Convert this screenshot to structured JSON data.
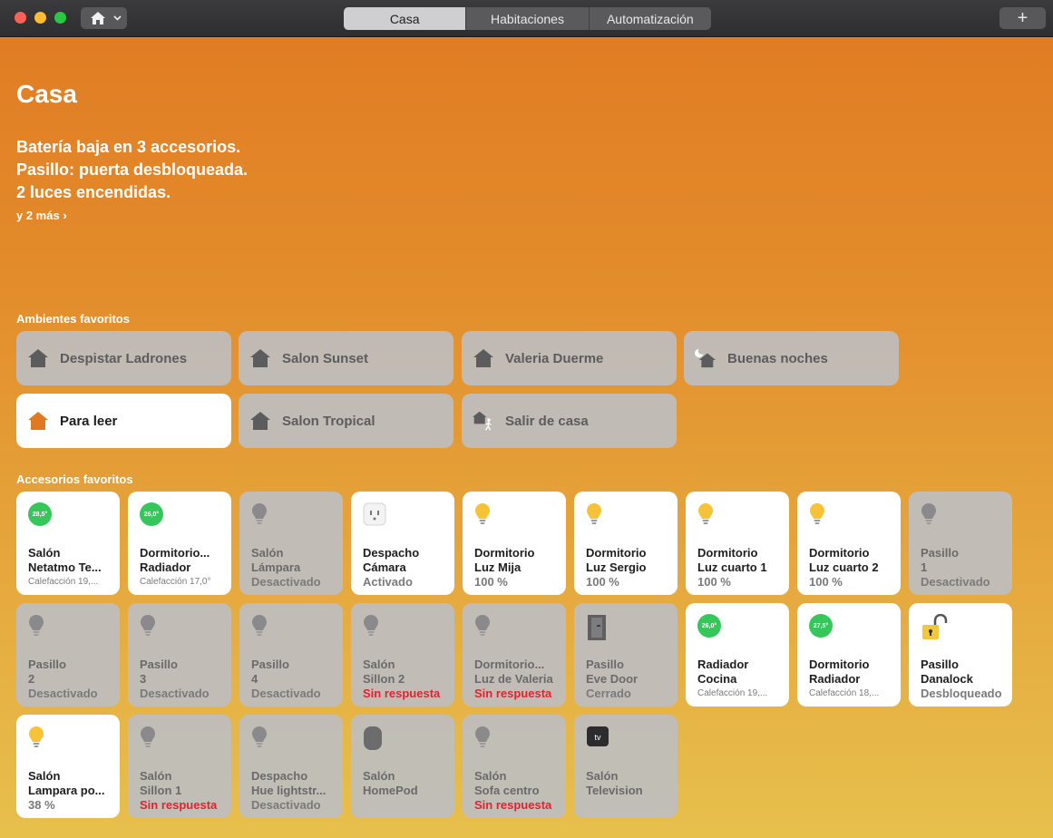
{
  "toolbar": {
    "tabs": [
      {
        "label": "Casa",
        "active": true
      },
      {
        "label": "Habitaciones",
        "active": false
      },
      {
        "label": "Automatización",
        "active": false
      }
    ],
    "add_label": "+"
  },
  "page": {
    "title": "Casa",
    "status_lines": [
      "Batería baja en 3 accesorios.",
      "Pasillo: puerta desbloqueada.",
      "2 luces encendidas."
    ],
    "more_link": "y 2 más ›"
  },
  "scenes_section": {
    "title": "Ambientes favoritos",
    "items": [
      {
        "label": "Despistar Ladrones",
        "on": false,
        "icon": "house-icon"
      },
      {
        "label": "Salon Sunset",
        "on": false,
        "icon": "house-icon"
      },
      {
        "label": "Valeria Duerme",
        "on": false,
        "icon": "house-icon"
      },
      {
        "label": "Buenas noches",
        "on": false,
        "icon": "moon-house-icon"
      },
      {
        "label": "Para leer",
        "on": true,
        "icon": "house-icon"
      },
      {
        "label": "Salon Tropical",
        "on": false,
        "icon": "house-icon"
      },
      {
        "label": "Salir de casa",
        "on": false,
        "icon": "leave-house-icon"
      }
    ]
  },
  "accessories_section": {
    "title": "Accesorios favoritos",
    "items": [
      {
        "room": "Salón",
        "name": "Netatmo Te...",
        "state": "Calefacción 19,...",
        "badge": "28,5°",
        "on": true,
        "icon": "thermostat-icon"
      },
      {
        "room": "Dormitorio...",
        "name": "Radiador",
        "state": "Calefacción 17,0°",
        "badge": "26,0°",
        "on": true,
        "icon": "thermostat-icon"
      },
      {
        "room": "Salón",
        "name": "Lámpara",
        "state": "Desactivado",
        "on": false,
        "icon": "bulb-icon"
      },
      {
        "room": "Despacho",
        "name": "Cámara",
        "state": "Activado",
        "on": true,
        "icon": "outlet-icon"
      },
      {
        "room": "Dormitorio",
        "name": "Luz Mija",
        "state": "100 %",
        "on": true,
        "icon": "bulb-icon"
      },
      {
        "room": "Dormitorio",
        "name": "Luz Sergio",
        "state": "100 %",
        "on": true,
        "icon": "bulb-icon"
      },
      {
        "room": "Dormitorio",
        "name": "Luz cuarto 1",
        "state": "100 %",
        "on": true,
        "icon": "bulb-icon"
      },
      {
        "room": "Dormitorio",
        "name": "Luz cuarto 2",
        "state": "100 %",
        "on": true,
        "icon": "bulb-icon"
      },
      {
        "room": "Pasillo",
        "name": "1",
        "state": "Desactivado",
        "on": false,
        "icon": "bulb-icon"
      },
      {
        "room": "Pasillo",
        "name": "2",
        "state": "Desactivado",
        "on": false,
        "icon": "bulb-icon"
      },
      {
        "room": "Pasillo",
        "name": "3",
        "state": "Desactivado",
        "on": false,
        "icon": "bulb-icon"
      },
      {
        "room": "Pasillo",
        "name": "4",
        "state": "Desactivado",
        "on": false,
        "icon": "bulb-icon"
      },
      {
        "room": "Salón",
        "name": "Sillon 2",
        "state": "Sin respuesta",
        "on": false,
        "alert": true,
        "icon": "bulb-icon"
      },
      {
        "room": "Dormitorio...",
        "name": "Luz de Valeria",
        "state": "Sin respuesta",
        "on": false,
        "alert": true,
        "icon": "bulb-icon"
      },
      {
        "room": "Pasillo",
        "name": "Eve Door",
        "state": "Cerrado",
        "on": false,
        "icon": "door-icon"
      },
      {
        "room": "Radiador",
        "name": "Cocina",
        "state": "Calefacción 19,...",
        "badge": "26,0°",
        "on": true,
        "icon": "thermostat-icon"
      },
      {
        "room": "Dormitorio",
        "name": "Radiador",
        "state": "Calefacción 18,...",
        "badge": "27,5°",
        "on": true,
        "icon": "thermostat-icon"
      },
      {
        "room": "Pasillo",
        "name": "Danalock",
        "state": "Desbloqueado",
        "on": true,
        "alert": true,
        "icon": "lock-open-icon"
      },
      {
        "room": "Salón",
        "name": "Lampara po...",
        "state": "38 %",
        "on": true,
        "icon": "bulb-icon"
      },
      {
        "room": "Salón",
        "name": "Sillon 1",
        "state": "Sin respuesta",
        "on": false,
        "alert": true,
        "icon": "bulb-icon"
      },
      {
        "room": "Despacho",
        "name": "Hue lightstr...",
        "state": "Desactivado",
        "on": false,
        "icon": "bulb-icon"
      },
      {
        "room": "Salón",
        "name": "HomePod",
        "state": "",
        "on": false,
        "icon": "homepod-icon"
      },
      {
        "room": "Salón",
        "name": "Sofa centro",
        "state": "Sin respuesta",
        "on": false,
        "alert": true,
        "icon": "bulb-icon"
      },
      {
        "room": "Salón",
        "name": "Television",
        "state": "",
        "on": false,
        "icon": "appletv-icon",
        "icon_text": "tv"
      }
    ]
  },
  "colors": {
    "accent_orange": "#e07a22",
    "light_on": "#f6c338",
    "thermo_green": "#35c75a",
    "alert_red": "#e0242f"
  }
}
